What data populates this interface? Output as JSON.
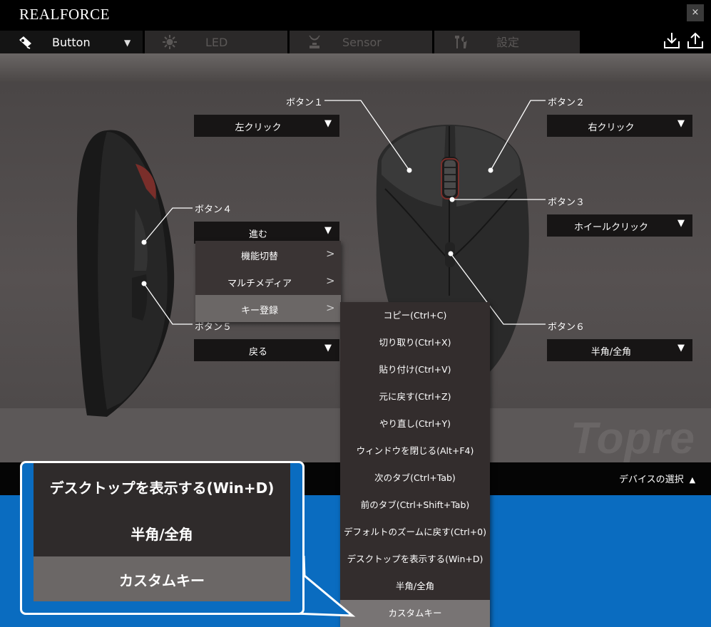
{
  "app": {
    "logo": "REALFORCE",
    "close": "×"
  },
  "tabs": [
    {
      "label": "Button",
      "active": true,
      "icon": "button-icon"
    },
    {
      "label": "LED",
      "active": false,
      "icon": "led-icon"
    },
    {
      "label": "Sensor",
      "active": false,
      "icon": "sensor-icon"
    },
    {
      "label": "設定",
      "active": false,
      "icon": "tools-icon"
    }
  ],
  "tab_caret": "▼",
  "header_icons": [
    "import-icon",
    "export-icon"
  ],
  "buttons": {
    "b1": {
      "label": "ボタン１",
      "value": "左クリック"
    },
    "b2": {
      "label": "ボタン２",
      "value": "右クリック"
    },
    "b3": {
      "label": "ボタン３",
      "value": "ホイールクリック"
    },
    "b4": {
      "label": "ボタン４",
      "value": "進む"
    },
    "b5": {
      "label": "ボタン５",
      "value": "戻る"
    },
    "b6": {
      "label": "ボタン６",
      "value": "半角/全角"
    }
  },
  "dropdown_arrow": "▼",
  "submenu": [
    {
      "label": "機能切替",
      "chevron": ">"
    },
    {
      "label": "マルチメディア",
      "chevron": ">"
    },
    {
      "label": "キー登録",
      "chevron": ">",
      "selected": true
    }
  ],
  "key_list": [
    "コピー(Ctrl+C)",
    "切り取り(Ctrl+X)",
    "貼り付け(Ctrl+V)",
    "元に戻す(Ctrl+Z)",
    "やり直し(Ctrl+Y)",
    "ウィンドウを閉じる(Alt+F4)",
    "次のタブ(Ctrl+Tab)",
    "前のタブ(Ctrl+Shift+Tab)",
    "デフォルトのズームに戻す(Ctrl+0)",
    "デスクトップを表示する(Win+D)",
    "半角/全角",
    "カスタムキー"
  ],
  "key_list_selected": "カスタムキー",
  "brand_watermark": "Topre",
  "device_select": {
    "label": "デバイスの選択",
    "arrow": "▲"
  },
  "callout": {
    "items": [
      "デスクトップを表示する(Win+D)",
      "半角/全角",
      "カスタムキー"
    ],
    "selected": "カスタムキー"
  },
  "colors": {
    "accent_blue": "#0a6cc0",
    "panel_dark": "#171515",
    "selected_gray": "#6b6766"
  }
}
